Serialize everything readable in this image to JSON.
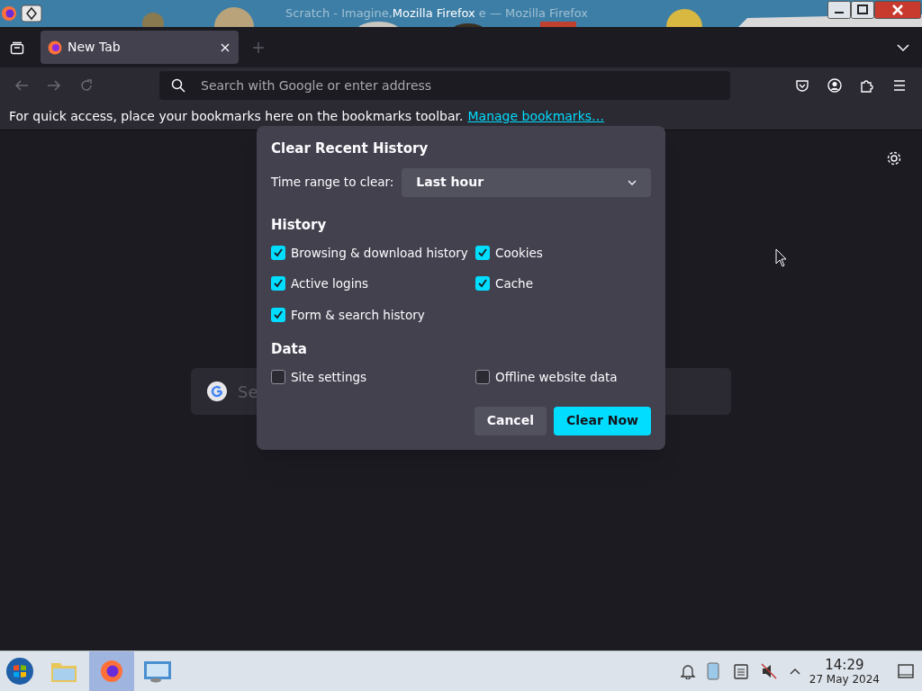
{
  "window": {
    "title_behind_left": "Scratch - Imagine,",
    "title": "Mozilla Firefox",
    "title_behind_right": "e — Mozilla Firefox"
  },
  "tabs": [
    {
      "label": "New Tab",
      "selected": true
    }
  ],
  "address_bar": {
    "placeholder": "Search with Google or enter address"
  },
  "bookmarks_bar": {
    "message": "For quick access, place your bookmarks here on the bookmarks toolbar.",
    "link": "Manage bookmarks…"
  },
  "page_search": {
    "placeholder": "Se"
  },
  "dialog": {
    "title": "Clear Recent History",
    "time_range_label": "Time range to clear:",
    "time_range_value": "Last hour",
    "sections": [
      {
        "heading": "History",
        "options": [
          {
            "label": "Browsing & download history",
            "checked": true
          },
          {
            "label": "Cookies",
            "checked": true
          },
          {
            "label": "Active logins",
            "checked": true
          },
          {
            "label": "Cache",
            "checked": true
          },
          {
            "label": "Form & search history",
            "checked": true
          }
        ]
      },
      {
        "heading": "Data",
        "options": [
          {
            "label": "Site settings",
            "checked": false
          },
          {
            "label": "Offline website data",
            "checked": false
          }
        ]
      }
    ],
    "buttons": [
      {
        "label": "Cancel",
        "kind": "secondary"
      },
      {
        "label": "Clear Now",
        "kind": "primary"
      }
    ]
  },
  "taskbar": {
    "time": "14:29",
    "date": "27 May 2024"
  }
}
